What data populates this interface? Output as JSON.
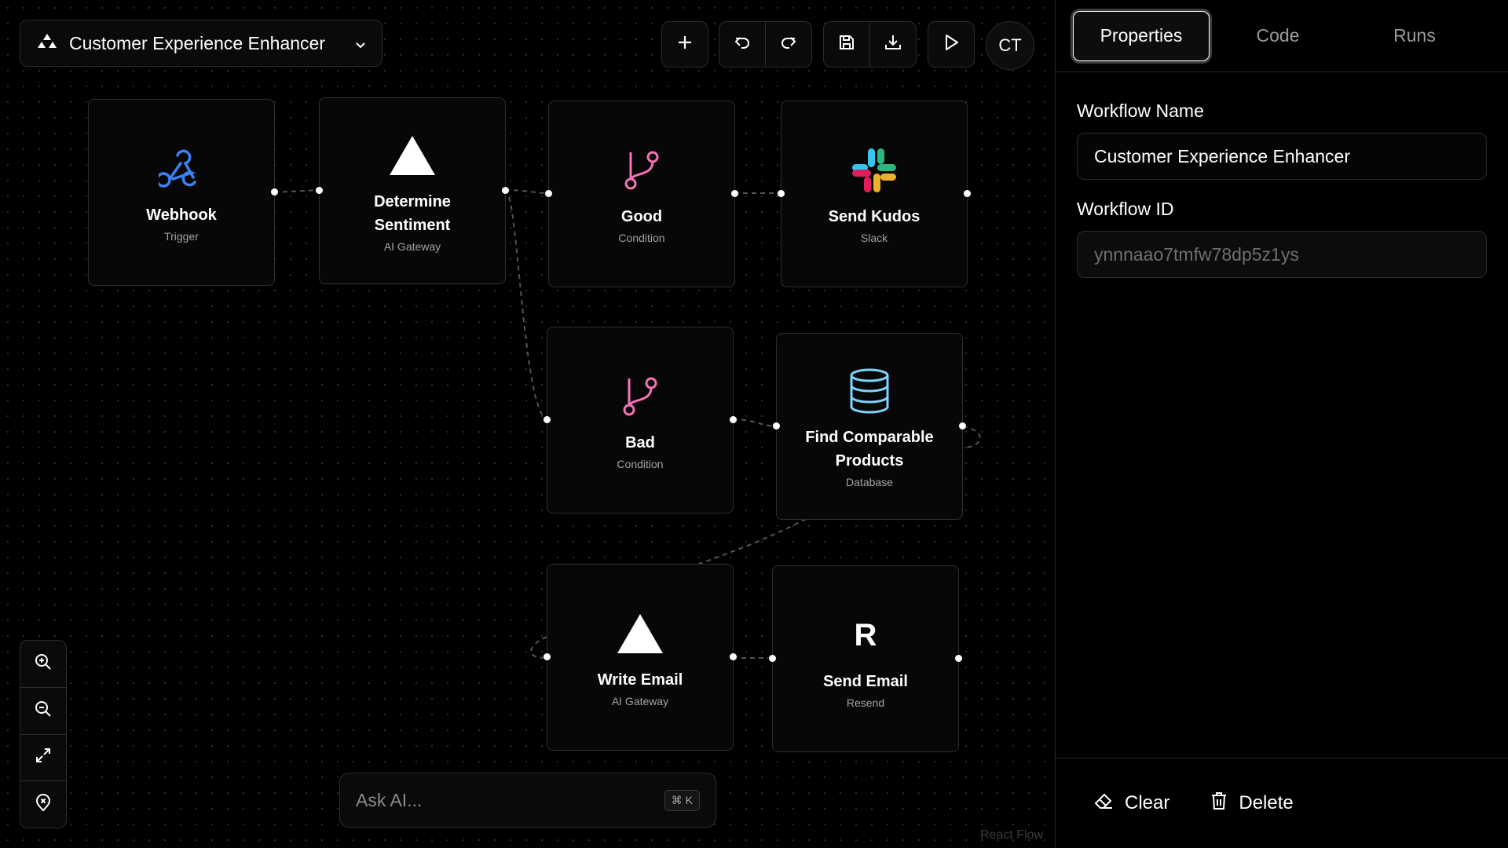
{
  "workflow": {
    "name": "Customer Experience Enhancer"
  },
  "toolbar": {
    "add": "plus-icon",
    "undo": "undo-icon",
    "redo": "redo-icon",
    "save": "save-icon",
    "download": "download-icon",
    "run": "play-icon",
    "avatar": "CT"
  },
  "nodes": [
    {
      "id": "webhook",
      "title": "Webhook",
      "subtitle": "Trigger",
      "icon": "webhook-icon",
      "color": "#3b82f6"
    },
    {
      "id": "sentiment",
      "title": "Determine Sentiment",
      "subtitle": "AI Gateway",
      "icon": "triangle-icon",
      "color": "#ffffff"
    },
    {
      "id": "good",
      "title": "Good",
      "subtitle": "Condition",
      "icon": "git-branch-icon",
      "color": "#f472b6"
    },
    {
      "id": "kudos",
      "title": "Send Kudos",
      "subtitle": "Slack",
      "icon": "slack-icon",
      "color": "#e01e5a"
    },
    {
      "id": "bad",
      "title": "Bad",
      "subtitle": "Condition",
      "icon": "git-branch-icon",
      "color": "#f472b6"
    },
    {
      "id": "products",
      "title": "Find Comparable Products",
      "subtitle": "Database",
      "icon": "database-icon",
      "color": "#7dd3fc"
    },
    {
      "id": "write_email",
      "title": "Write Email",
      "subtitle": "AI Gateway",
      "icon": "triangle-icon",
      "color": "#ffffff"
    },
    {
      "id": "send_email",
      "title": "Send Email",
      "subtitle": "Resend",
      "icon": "resend-icon",
      "color": "#ffffff",
      "glyph": "R"
    }
  ],
  "ask_ai": {
    "placeholder": "Ask AI...",
    "shortcut": "⌘ K"
  },
  "attribution": "React Flow",
  "panel": {
    "tabs": [
      "Properties",
      "Code",
      "Runs"
    ],
    "active_tab": "Properties",
    "workflow_name_label": "Workflow Name",
    "workflow_name_value": "Customer Experience Enhancer",
    "workflow_id_label": "Workflow ID",
    "workflow_id_value": "ynnnaao7tmfw78dp5z1ys",
    "clear_label": "Clear",
    "delete_label": "Delete"
  }
}
